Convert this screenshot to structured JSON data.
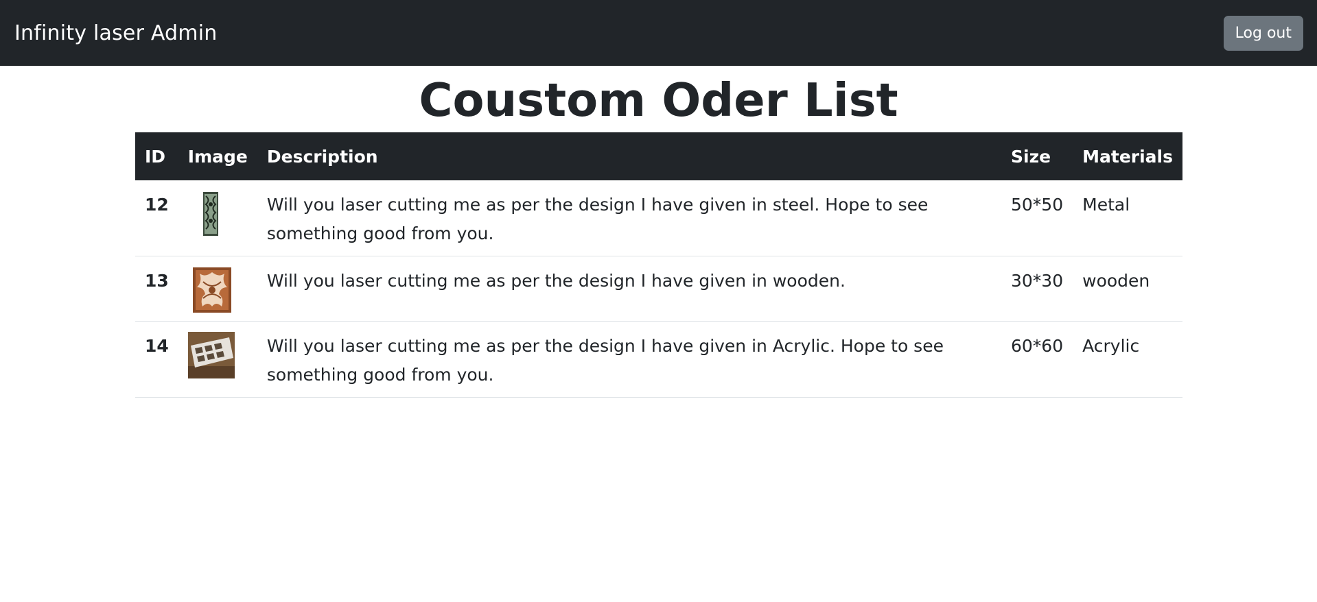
{
  "navbar": {
    "brand": "Infinity laser Admin",
    "logout_label": "Log out"
  },
  "page": {
    "title": "Coustom Oder List"
  },
  "table": {
    "headers": {
      "id": "ID",
      "image": "Image",
      "description": "Description",
      "size": "Size",
      "materials": "Materials"
    },
    "rows": [
      {
        "id": "12",
        "image": "steel-panel-thumbnail",
        "description": "Will you laser cutting me as per the design I have given in steel. Hope to see something good from you.",
        "size": "50*50",
        "materials": "Metal"
      },
      {
        "id": "13",
        "image": "wooden-panel-thumbnail",
        "description": "Will you laser cutting me as per the design I have given in wooden.",
        "size": "30*30",
        "materials": "wooden"
      },
      {
        "id": "14",
        "image": "acrylic-panel-thumbnail",
        "description": "Will you laser cutting me as per the design I have given in Acrylic. Hope to see something good from you.",
        "size": "60*60",
        "materials": "Acrylic"
      }
    ]
  },
  "colors": {
    "navbar_bg": "#212529",
    "button_bg": "#6c757d",
    "row_border": "#dee2e6"
  }
}
